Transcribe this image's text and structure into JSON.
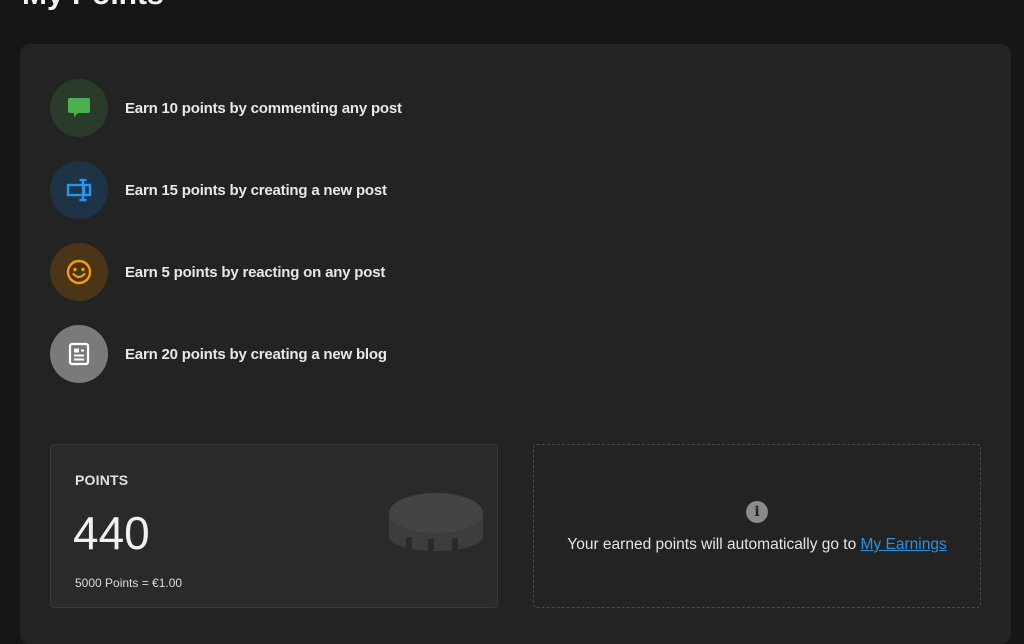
{
  "header": {
    "title": "My Points"
  },
  "rules": [
    {
      "text": "Earn 10 points by commenting any post",
      "icon": "comment-icon",
      "bg": "#2a3b2c",
      "fg": "#4caf50"
    },
    {
      "text": "Earn 15 points by creating a new post",
      "icon": "create-post-icon",
      "bg": "#1f3347",
      "fg": "#2196f3"
    },
    {
      "text": "Earn 5 points by reacting on any post",
      "icon": "smile-icon",
      "bg": "#4a3519",
      "fg": "#f39c12"
    },
    {
      "text": "Earn 20 points by creating a new blog",
      "icon": "blog-icon",
      "bg": "#7a7a7a",
      "fg": "#ffffff"
    }
  ],
  "points": {
    "label": "POINTS",
    "value": "440",
    "rate": "5000 Points = €1.00"
  },
  "info": {
    "text": "Your earned points will automatically go to ",
    "link": "My Earnings"
  },
  "colors": {
    "background": "#161616",
    "card": "#232323",
    "link": "#2f8fe0"
  }
}
